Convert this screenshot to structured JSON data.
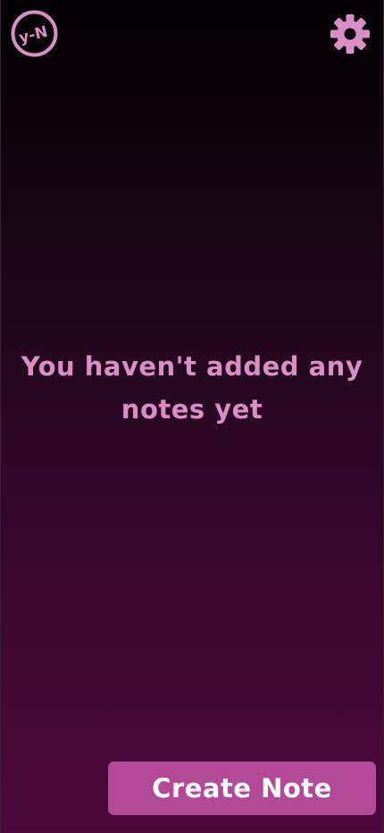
{
  "header": {
    "logo": {
      "icon": "app-logo-icon",
      "text": "y-N",
      "color": "#d98fc6"
    },
    "settings": {
      "icon": "gear-icon",
      "color": "#d98fc6"
    }
  },
  "main": {
    "empty_message": "You haven't added any notes yet"
  },
  "footer": {
    "create_label": "Create Note"
  },
  "colors": {
    "accent": "#d98fc6",
    "button": "#b24a98",
    "background_top": "#020002",
    "background_bottom": "#4d0a3d"
  }
}
